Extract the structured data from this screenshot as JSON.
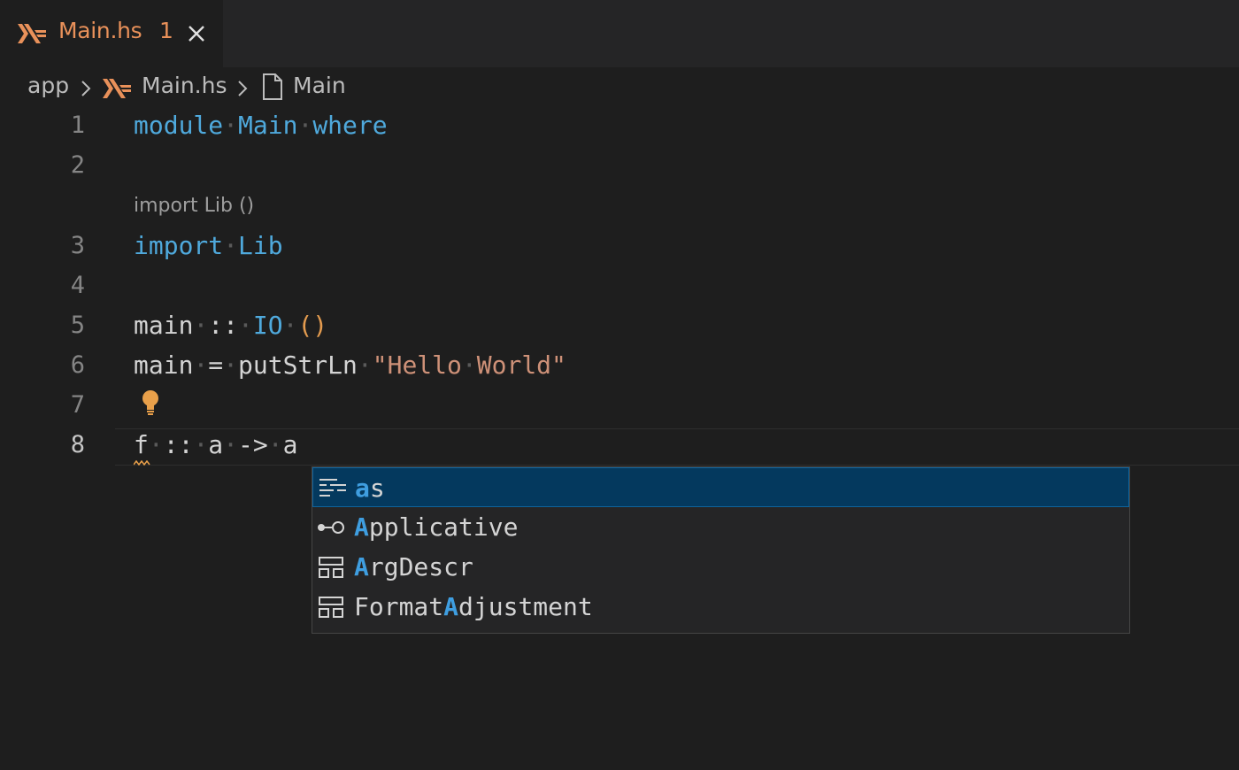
{
  "tab": {
    "title": "Main.hs",
    "problem_count": "1",
    "icon": "haskell-icon",
    "close_icon": "close-icon"
  },
  "breadcrumb": {
    "folder": "app",
    "file": "Main.hs",
    "symbol": "Main"
  },
  "editor": {
    "code_lens": "import Lib ()",
    "lines": [
      {
        "number": "1",
        "text": "module Main where"
      },
      {
        "number": "2",
        "text": ""
      },
      {
        "number": "3",
        "text": "import Lib"
      },
      {
        "number": "4",
        "text": ""
      },
      {
        "number": "5",
        "text": "main :: IO ()"
      },
      {
        "number": "6",
        "text": "main = putStrLn \"Hello World\""
      },
      {
        "number": "7",
        "text": ""
      },
      {
        "number": "8",
        "text": "f :: a -> a"
      }
    ],
    "active_line": "8"
  },
  "suggestions": {
    "items": [
      {
        "match": "a",
        "rest": "s",
        "prefix": "",
        "icon": "keyword-snippet-icon",
        "selected": true
      },
      {
        "match": "A",
        "rest": "pplicative",
        "prefix": "",
        "icon": "interface-icon",
        "selected": false
      },
      {
        "match": "A",
        "rest": "rgDescr",
        "prefix": "",
        "icon": "struct-icon",
        "selected": false
      },
      {
        "match": "A",
        "rest": "djustment",
        "prefix": "Format",
        "icon": "struct-icon",
        "selected": false
      }
    ]
  },
  "colors": {
    "background": "#1e1e1e",
    "tab_text": "#e9915a",
    "keyword": "#4fa9dc",
    "string": "#ce9178",
    "selection": "#04395e"
  }
}
